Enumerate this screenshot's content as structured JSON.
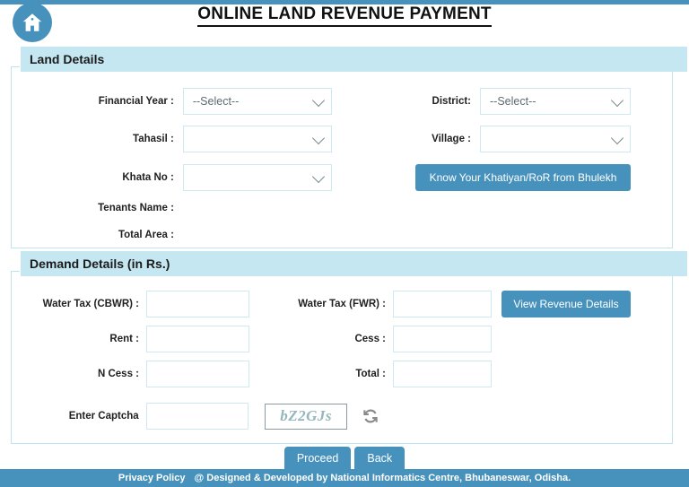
{
  "header": {
    "title": "ONLINE LAND REVENUE PAYMENT",
    "home_icon": "home-icon"
  },
  "colors": {
    "accent_blue": "#4792bd",
    "panel_header_cyan": "#c5e7f1",
    "field_border": "#cfe9f2",
    "captcha_text": "#93b7bd"
  },
  "land_details": {
    "legend": "Land Details",
    "left_fields": [
      {
        "label": "Financial Year :",
        "value": "--Select--",
        "type": "select"
      },
      {
        "label": "Tahasil :",
        "value": "",
        "type": "select"
      },
      {
        "label": "Khata No :",
        "value": "",
        "type": "select"
      },
      {
        "label": "Tenants Name :",
        "value": "",
        "type": "text-only"
      },
      {
        "label": "Total Area :",
        "value": "",
        "type": "text-only"
      }
    ],
    "right_fields": [
      {
        "label": "District:",
        "value": "--Select--",
        "type": "select"
      },
      {
        "label": "Village :",
        "value": "",
        "type": "select"
      }
    ],
    "bhulekh_button": "Know Your Khatiyan/RoR from Bhulekh"
  },
  "demand_details": {
    "legend": "Demand Details (in Rs.)",
    "left_fields": [
      {
        "label": "Water Tax (CBWR) :",
        "value": ""
      },
      {
        "label": "Rent :",
        "value": ""
      },
      {
        "label": "N Cess :",
        "value": ""
      }
    ],
    "right_fields": [
      {
        "label": "Water Tax (FWR) :",
        "value": ""
      },
      {
        "label": "Cess :",
        "value": ""
      },
      {
        "label": "Total :",
        "value": ""
      }
    ],
    "view_revenue_button": "View Revenue Details",
    "captcha": {
      "label": "Enter Captcha",
      "input_value": "",
      "image_text": "bZ2GJs",
      "refresh_icon": "refresh-icon"
    }
  },
  "actions": {
    "proceed": "Proceed",
    "back": "Back"
  },
  "footer": {
    "privacy_policy": "Privacy Policy",
    "credit": "@ Designed & Developed by National Informatics Centre, Bhubaneswar, Odisha."
  }
}
